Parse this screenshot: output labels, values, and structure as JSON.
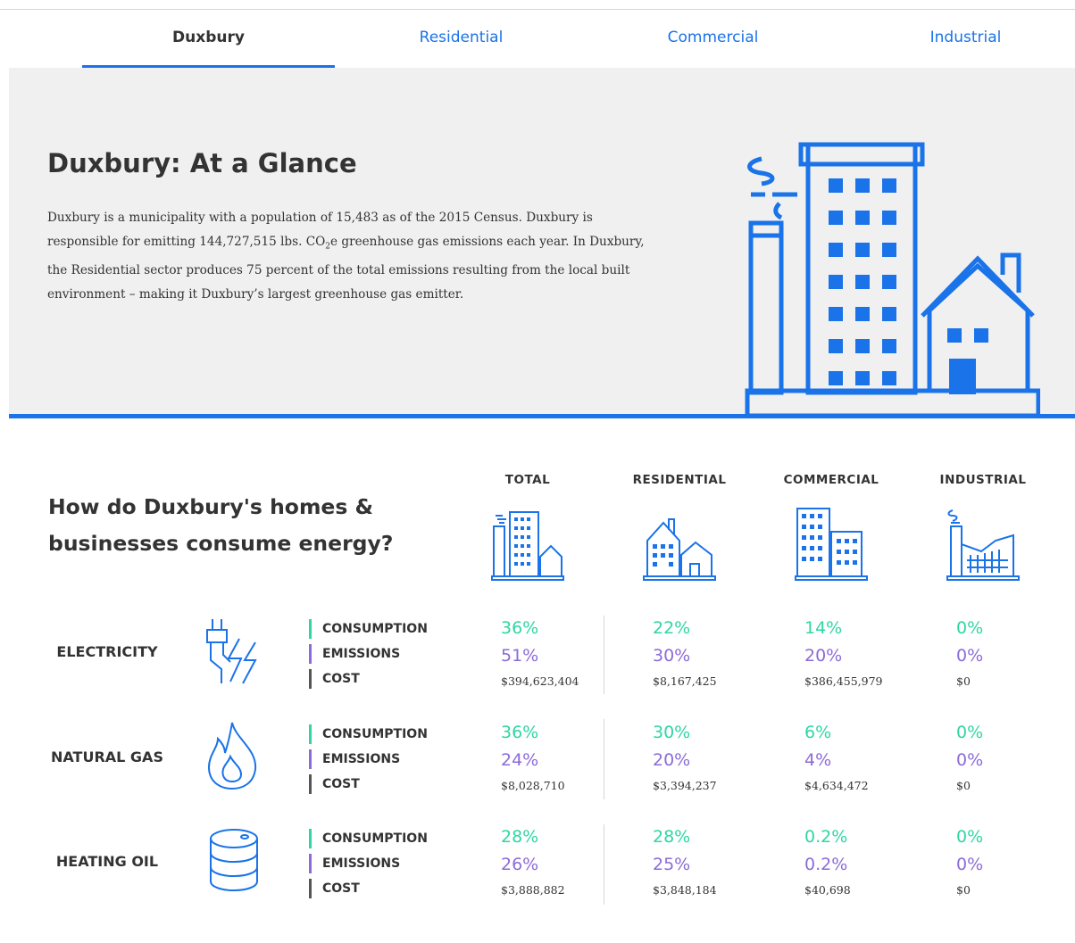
{
  "tabs": [
    {
      "label": "Duxbury",
      "active": true
    },
    {
      "label": "Residential",
      "active": false
    },
    {
      "label": "Commercial",
      "active": false
    },
    {
      "label": "Industrial",
      "active": false
    }
  ],
  "hero": {
    "title": "Duxbury: At a Glance",
    "text_1": "Duxbury is a municipality with a population of 15,483 as of the 2015 Census. Duxbury is responsible for emitting 144,727,515 lbs. CO",
    "text_sub": "2",
    "text_2": "e greenhouse gas emissions each year. In Duxbury, the Residential sector produces 75 percent of the total emissions resulting from the local built environment – making it Duxbury’s largest greenhouse gas emitter."
  },
  "section": {
    "title": "How do Duxbury's homes & businesses consume energy?"
  },
  "columns": [
    "TOTAL",
    "RESIDENTIAL",
    "COMMERCIAL",
    "INDUSTRIAL"
  ],
  "metric_labels": {
    "consumption": "CONSUMPTION",
    "emissions": "EMISSIONS",
    "cost": "COST"
  },
  "rows": [
    {
      "label": "ELECTRICITY",
      "icon": "electric-plug-icon",
      "consumption": [
        "36%",
        "22%",
        "14%",
        "0%"
      ],
      "emissions": [
        "51%",
        "30%",
        "20%",
        "0%"
      ],
      "cost": [
        "$394,623,404",
        "$8,167,425",
        "$386,455,979",
        "$0"
      ]
    },
    {
      "label": "NATURAL GAS",
      "icon": "flame-icon",
      "consumption": [
        "36%",
        "30%",
        "6%",
        "0%"
      ],
      "emissions": [
        "24%",
        "20%",
        "4%",
        "0%"
      ],
      "cost": [
        "$8,028,710",
        "$3,394,237",
        "$4,634,472",
        "$0"
      ]
    },
    {
      "label": "HEATING OIL",
      "icon": "oil-barrel-icon",
      "consumption": [
        "28%",
        "28%",
        "0.2%",
        "0%"
      ],
      "emissions": [
        "26%",
        "25%",
        "0.2%",
        "0%"
      ],
      "cost": [
        "$3,888,882",
        "$3,848,184",
        "$40,698",
        "$0"
      ]
    }
  ],
  "colors": {
    "accent": "#1a73e8",
    "consumption": "#2fd6a3",
    "emissions": "#8c6bd8",
    "cost": "#555555",
    "hero_bg": "#f0f0f1"
  }
}
